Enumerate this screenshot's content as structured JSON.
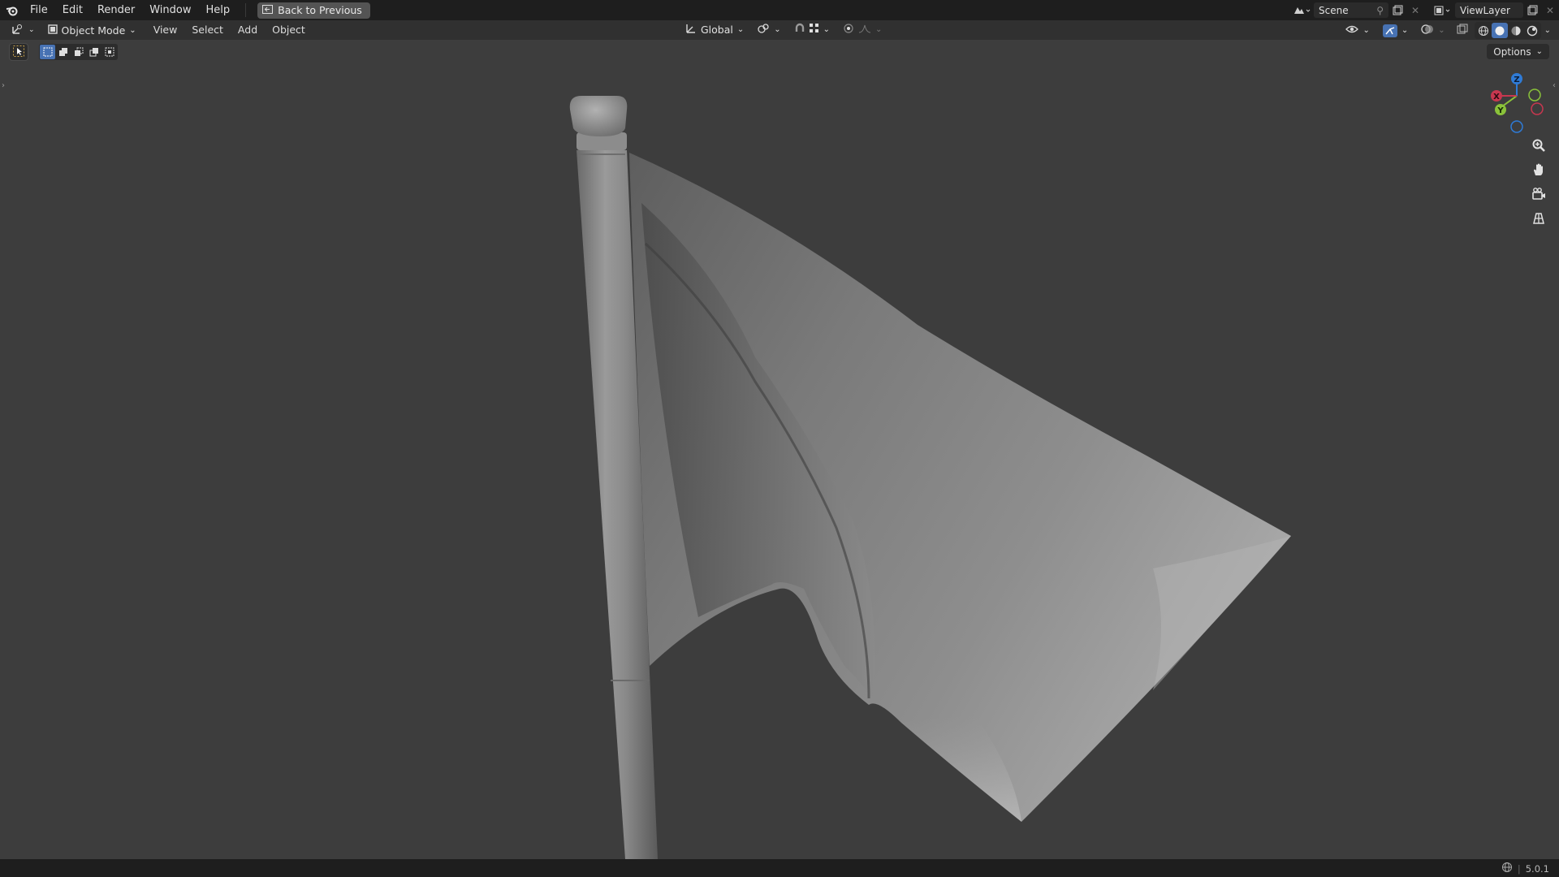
{
  "topbar": {
    "menus": [
      "File",
      "Edit",
      "Render",
      "Window",
      "Help"
    ],
    "back_button": "Back to Previous",
    "scene_name": "Scene",
    "view_layer": "ViewLayer"
  },
  "header": {
    "mode": "Object Mode",
    "menus": [
      "View",
      "Select",
      "Add",
      "Object"
    ],
    "transform_orientation": "Global",
    "options_label": "Options"
  },
  "gizmo": {
    "z_label": "Z",
    "y_label": "Y",
    "x_label": "X"
  },
  "status": {
    "version": "5.0.1"
  },
  "icons": [
    "blender-logo-icon",
    "back-icon",
    "editor-type-icon",
    "object-mode-icon",
    "orientation-icon",
    "pivot-icon",
    "snap-icon",
    "proportional-icon",
    "visibility-icon",
    "gizmo-icon",
    "overlay-icon",
    "xray-icon",
    "wireframe-shading-icon",
    "solid-shading-icon",
    "material-shading-icon",
    "rendered-shading-icon",
    "zoom-icon",
    "pan-hand-icon",
    "camera-icon",
    "grid-view-icon",
    "network-icon"
  ],
  "colors": {
    "x_axis": "#c7374f",
    "y_axis": "#8ac23a",
    "z_axis": "#2f7bd6",
    "active_blue": "#4772b3"
  }
}
